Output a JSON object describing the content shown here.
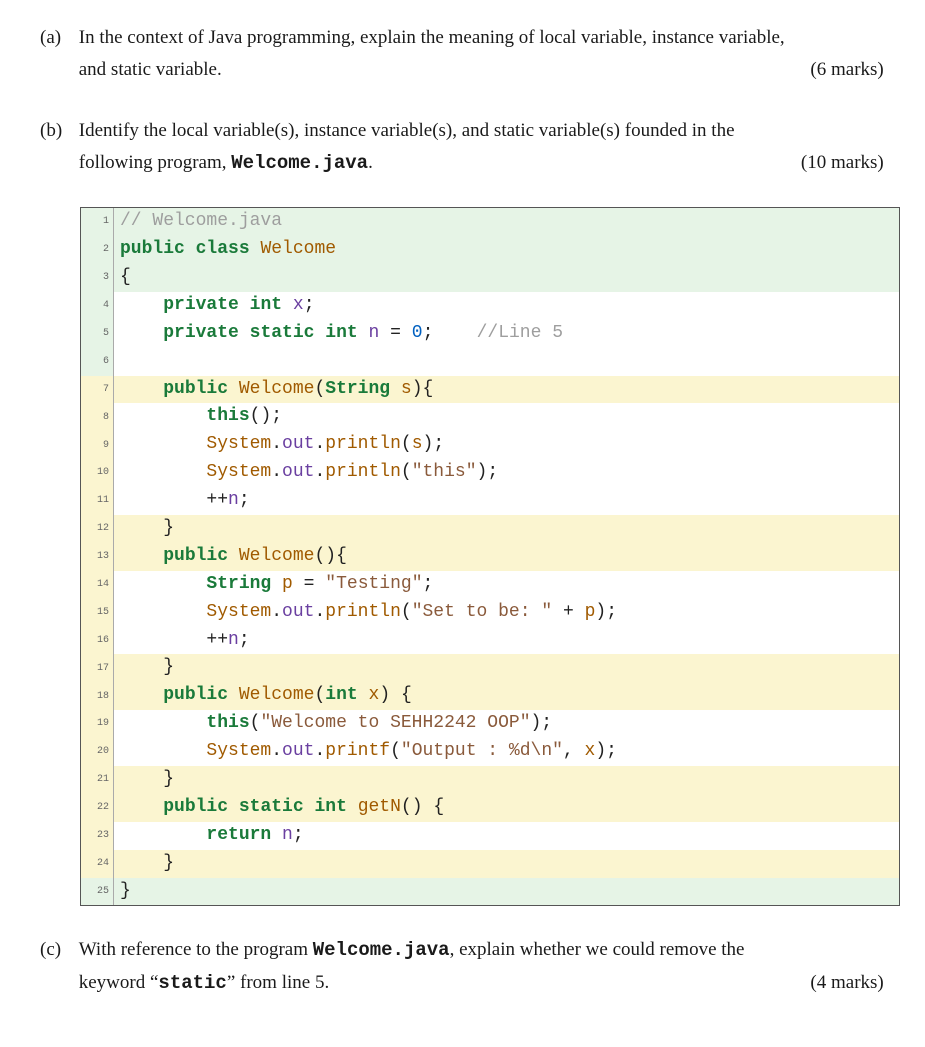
{
  "questions": {
    "a": {
      "label": "(a)",
      "text_1": "In the context of Java programming, explain the meaning of local variable, instance variable,",
      "text_2": "and static variable.",
      "marks": "(6 marks)"
    },
    "b": {
      "label": "(b)",
      "text_1": "Identify the local variable(s), instance variable(s), and static variable(s) founded in the",
      "text_2_prefix": "following program, ",
      "program_name": "Welcome.java",
      "text_2_suffix": ".",
      "marks": "(10 marks)"
    },
    "c": {
      "label": "(c)",
      "text_1_prefix": "With reference to the program ",
      "program_name": "Welcome.java",
      "text_1_suffix": ", explain whether we could remove the",
      "text_2_prefix": "keyword “",
      "keyword": "static",
      "text_2_suffix": "” from line 5.",
      "marks": "(4 marks)"
    }
  },
  "code": {
    "lines": [
      {
        "n": "1",
        "bg": "bg-green",
        "tokens": [
          [
            "tk-comment",
            "// Welcome.java"
          ]
        ]
      },
      {
        "n": "2",
        "bg": "bg-green",
        "tokens": [
          [
            "tk-keyword",
            "public"
          ],
          [
            "",
            " "
          ],
          [
            "tk-keyword",
            "class"
          ],
          [
            "",
            " "
          ],
          [
            "tk-ident",
            "Welcome"
          ]
        ]
      },
      {
        "n": "3",
        "bg": "bg-green",
        "tokens": [
          [
            "tk-punct",
            "{"
          ]
        ]
      },
      {
        "n": "4",
        "bg": "bg-white bg-gutter-green",
        "tokens": [
          [
            "",
            "    "
          ],
          [
            "tk-keyword",
            "private"
          ],
          [
            "",
            " "
          ],
          [
            "tk-type",
            "int"
          ],
          [
            "",
            " "
          ],
          [
            "tk-field",
            "x"
          ],
          [
            "tk-punct",
            ";"
          ]
        ]
      },
      {
        "n": "5",
        "bg": "bg-white bg-gutter-green",
        "tokens": [
          [
            "",
            "    "
          ],
          [
            "tk-keyword",
            "private"
          ],
          [
            "",
            " "
          ],
          [
            "tk-keyword",
            "static"
          ],
          [
            "",
            " "
          ],
          [
            "tk-type",
            "int"
          ],
          [
            "",
            " "
          ],
          [
            "tk-field",
            "n"
          ],
          [
            "",
            " "
          ],
          [
            "tk-punct",
            "="
          ],
          [
            "",
            " "
          ],
          [
            "tk-num",
            "0"
          ],
          [
            "tk-punct",
            ";"
          ],
          [
            "",
            "    "
          ],
          [
            "tk-comment",
            "//Line 5"
          ]
        ]
      },
      {
        "n": "6",
        "bg": "bg-white bg-gutter-green",
        "tokens": [
          [
            "",
            " "
          ]
        ]
      },
      {
        "n": "7",
        "bg": "bg-yellow",
        "tokens": [
          [
            "",
            "    "
          ],
          [
            "tk-keyword",
            "public"
          ],
          [
            "",
            " "
          ],
          [
            "tk-method",
            "Welcome"
          ],
          [
            "tk-punct",
            "("
          ],
          [
            "tk-type",
            "String"
          ],
          [
            "",
            " "
          ],
          [
            "tk-ident",
            "s"
          ],
          [
            "tk-punct",
            ")"
          ],
          [
            "tk-punct",
            "{"
          ]
        ]
      },
      {
        "n": "8",
        "bg": "bg-white bg-gutter-yellow",
        "tokens": [
          [
            "",
            "        "
          ],
          [
            "tk-keyword",
            "this"
          ],
          [
            "tk-punct",
            "();"
          ]
        ]
      },
      {
        "n": "9",
        "bg": "bg-white bg-gutter-yellow",
        "tokens": [
          [
            "",
            "        "
          ],
          [
            "tk-ident",
            "System"
          ],
          [
            "tk-punct",
            "."
          ],
          [
            "tk-field",
            "out"
          ],
          [
            "tk-punct",
            "."
          ],
          [
            "tk-method",
            "println"
          ],
          [
            "tk-punct",
            "("
          ],
          [
            "tk-ident",
            "s"
          ],
          [
            "tk-punct",
            ");"
          ]
        ]
      },
      {
        "n": "10",
        "bg": "bg-white bg-gutter-yellow",
        "tokens": [
          [
            "",
            "        "
          ],
          [
            "tk-ident",
            "System"
          ],
          [
            "tk-punct",
            "."
          ],
          [
            "tk-field",
            "out"
          ],
          [
            "tk-punct",
            "."
          ],
          [
            "tk-method",
            "println"
          ],
          [
            "tk-punct",
            "("
          ],
          [
            "tk-string",
            "\"this\""
          ],
          [
            "tk-punct",
            ");"
          ]
        ]
      },
      {
        "n": "11",
        "bg": "bg-white bg-gutter-yellow",
        "tokens": [
          [
            "",
            "        "
          ],
          [
            "tk-punct",
            "++"
          ],
          [
            "tk-field",
            "n"
          ],
          [
            "tk-punct",
            ";"
          ]
        ]
      },
      {
        "n": "12",
        "bg": "bg-yellow",
        "tokens": [
          [
            "",
            "    "
          ],
          [
            "tk-punct",
            "}"
          ]
        ]
      },
      {
        "n": "13",
        "bg": "bg-yellow",
        "tokens": [
          [
            "",
            "    "
          ],
          [
            "tk-keyword",
            "public"
          ],
          [
            "",
            " "
          ],
          [
            "tk-method",
            "Welcome"
          ],
          [
            "tk-punct",
            "(){"
          ]
        ]
      },
      {
        "n": "14",
        "bg": "bg-white bg-gutter-yellow",
        "tokens": [
          [
            "",
            "        "
          ],
          [
            "tk-type",
            "String"
          ],
          [
            "",
            " "
          ],
          [
            "tk-ident",
            "p"
          ],
          [
            "",
            " "
          ],
          [
            "tk-punct",
            "="
          ],
          [
            "",
            " "
          ],
          [
            "tk-string",
            "\"Testing\""
          ],
          [
            "tk-punct",
            ";"
          ]
        ]
      },
      {
        "n": "15",
        "bg": "bg-white bg-gutter-yellow",
        "tokens": [
          [
            "",
            "        "
          ],
          [
            "tk-ident",
            "System"
          ],
          [
            "tk-punct",
            "."
          ],
          [
            "tk-field",
            "out"
          ],
          [
            "tk-punct",
            "."
          ],
          [
            "tk-method",
            "println"
          ],
          [
            "tk-punct",
            "("
          ],
          [
            "tk-string",
            "\"Set to be: \""
          ],
          [
            "",
            " "
          ],
          [
            "tk-punct",
            "+"
          ],
          [
            "",
            " "
          ],
          [
            "tk-ident",
            "p"
          ],
          [
            "tk-punct",
            ");"
          ]
        ]
      },
      {
        "n": "16",
        "bg": "bg-white bg-gutter-yellow",
        "tokens": [
          [
            "",
            "        "
          ],
          [
            "tk-punct",
            "++"
          ],
          [
            "tk-field",
            "n"
          ],
          [
            "tk-punct",
            ";"
          ]
        ]
      },
      {
        "n": "17",
        "bg": "bg-yellow",
        "tokens": [
          [
            "",
            "    "
          ],
          [
            "tk-punct",
            "}"
          ]
        ]
      },
      {
        "n": "18",
        "bg": "bg-yellow",
        "tokens": [
          [
            "",
            "    "
          ],
          [
            "tk-keyword",
            "public"
          ],
          [
            "",
            " "
          ],
          [
            "tk-method",
            "Welcome"
          ],
          [
            "tk-punct",
            "("
          ],
          [
            "tk-type",
            "int"
          ],
          [
            "",
            " "
          ],
          [
            "tk-ident",
            "x"
          ],
          [
            "tk-punct",
            ")"
          ],
          [
            "",
            " "
          ],
          [
            "tk-punct",
            "{"
          ]
        ]
      },
      {
        "n": "19",
        "bg": "bg-white bg-gutter-yellow",
        "tokens": [
          [
            "",
            "        "
          ],
          [
            "tk-keyword",
            "this"
          ],
          [
            "tk-punct",
            "("
          ],
          [
            "tk-string",
            "\"Welcome to SEHH2242 OOP\""
          ],
          [
            "tk-punct",
            ");"
          ]
        ]
      },
      {
        "n": "20",
        "bg": "bg-white bg-gutter-yellow",
        "tokens": [
          [
            "",
            "        "
          ],
          [
            "tk-ident",
            "System"
          ],
          [
            "tk-punct",
            "."
          ],
          [
            "tk-field",
            "out"
          ],
          [
            "tk-punct",
            "."
          ],
          [
            "tk-method",
            "printf"
          ],
          [
            "tk-punct",
            "("
          ],
          [
            "tk-string",
            "\"Output : %d\\n\""
          ],
          [
            "tk-punct",
            ","
          ],
          [
            "",
            " "
          ],
          [
            "tk-ident",
            "x"
          ],
          [
            "tk-punct",
            ");"
          ]
        ]
      },
      {
        "n": "21",
        "bg": "bg-yellow",
        "tokens": [
          [
            "",
            "    "
          ],
          [
            "tk-punct",
            "}"
          ]
        ]
      },
      {
        "n": "22",
        "bg": "bg-yellow",
        "tokens": [
          [
            "",
            "    "
          ],
          [
            "tk-keyword",
            "public"
          ],
          [
            "",
            " "
          ],
          [
            "tk-keyword",
            "static"
          ],
          [
            "",
            " "
          ],
          [
            "tk-type",
            "int"
          ],
          [
            "",
            " "
          ],
          [
            "tk-method",
            "getN"
          ],
          [
            "tk-punct",
            "()"
          ],
          [
            "",
            " "
          ],
          [
            "tk-punct",
            "{"
          ]
        ]
      },
      {
        "n": "23",
        "bg": "bg-white bg-gutter-yellow",
        "tokens": [
          [
            "",
            "        "
          ],
          [
            "tk-keyword",
            "return"
          ],
          [
            "",
            " "
          ],
          [
            "tk-field",
            "n"
          ],
          [
            "tk-punct",
            ";"
          ]
        ]
      },
      {
        "n": "24",
        "bg": "bg-yellow",
        "tokens": [
          [
            "",
            "    "
          ],
          [
            "tk-punct",
            "}"
          ]
        ]
      },
      {
        "n": "25",
        "bg": "bg-green",
        "tokens": [
          [
            "tk-punct",
            "}"
          ]
        ]
      }
    ]
  }
}
